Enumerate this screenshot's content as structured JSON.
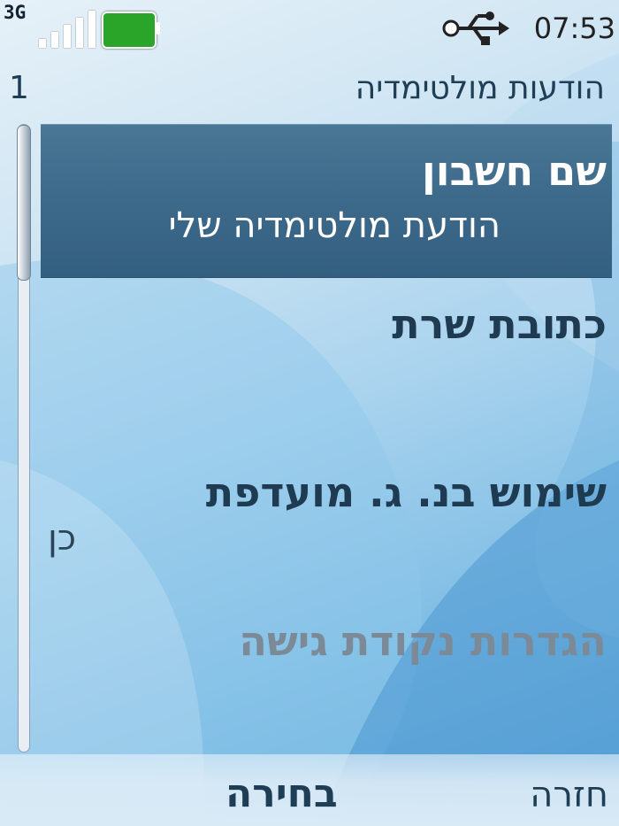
{
  "status_bar": {
    "network_type": "3G",
    "signal_icon": "signal-bars-icon",
    "battery_icon": "battery-icon",
    "usb_icon": "usb-connected-icon",
    "time": "07:53"
  },
  "title_bar": {
    "page_number": "1",
    "title": "הודעות מולטימדיה"
  },
  "settings_list": {
    "items": [
      {
        "label": "שם חשבון",
        "value": "הודעת מולטימדיה שלי",
        "selected": true
      },
      {
        "label": "כתובת שרת",
        "value": ""
      },
      {
        "label": "שימוש בנ. ג. מועדפת",
        "value": "כן"
      },
      {
        "label": "הגדרות נקודת גישה",
        "value": "",
        "disabled": true
      }
    ]
  },
  "softkeys": {
    "center": "בחירה",
    "right": "חזרה"
  },
  "colors": {
    "highlight": "#3e6a8b",
    "title_text": "#1e3e56",
    "disabled_text": "#7b8a96"
  }
}
